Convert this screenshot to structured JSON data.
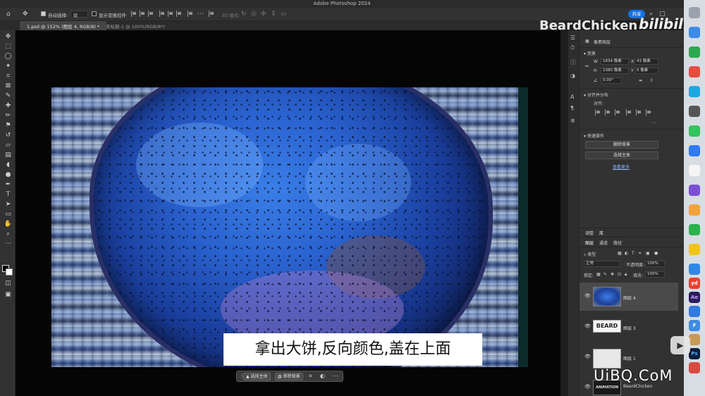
{
  "app": {
    "title": "Adobe Photoshop 2024"
  },
  "options_bar": {
    "auto_select_label": "自动选择:",
    "auto_select_value": "组",
    "show_transform_label": "显示变换控件",
    "mode_3d_label": "3D 模式:",
    "share_label": "共享"
  },
  "tabs": [
    {
      "label": "1.psd @ 152% (图层 4, RGB/8) *",
      "active": true
    },
    {
      "label": "未标题-1 @ 100%(RGB/8*)",
      "active": false
    }
  ],
  "subtitle": "拿出大饼,反向颜色,盖在上面",
  "context_bar": {
    "select_subject": "选择主体",
    "remove_background": "移除背景"
  },
  "watermark": {
    "brand": "BeardChicken",
    "site_logo": "bilibili",
    "uibq": "UiBQ.CoM"
  },
  "properties": {
    "pixel_layer_label": "像素图层",
    "transform_heading": "变换",
    "w_label": "W",
    "w_value": "1834 像素",
    "x_label": "X",
    "x_value": "43 像素",
    "h_label": "H",
    "h_value": "1080 像素",
    "y_label": "Y",
    "y_value": "0 像素",
    "angle_value": "0.00°",
    "align_heading": "对齐并分布",
    "align_label": "对齐:",
    "quick_actions_heading": "快速操作",
    "remove_bg_button": "删除背景",
    "select_subject_button": "选择主体",
    "view_more_link": "查看更多"
  },
  "panel_tabs": {
    "top": [
      "调整",
      "库"
    ],
    "layers": [
      "图层",
      "通道",
      "路径"
    ]
  },
  "layers_panel": {
    "filter_kind": "类型",
    "blend_mode": "正常",
    "opacity_label": "不透明度:",
    "opacity_value": "100%",
    "lock_label": "锁定:",
    "fill_label": "填充:",
    "fill_value": "100%",
    "layers": [
      {
        "name": "图层 4",
        "selected": true
      },
      {
        "name": "图层 3",
        "selected": false,
        "thumb_text": "BEARD"
      },
      {
        "name": "图层 1",
        "selected": false
      }
    ],
    "partial_thumb_text": "ANIMATION TIP",
    "partial_layer_name": "BeardChicken"
  },
  "dock_apps": [
    "yd",
    "Ae",
    "F",
    "Ps"
  ],
  "colors": {
    "accent": "#1473e6",
    "panel_bg": "#323232",
    "canvas_bg": "#050505"
  }
}
